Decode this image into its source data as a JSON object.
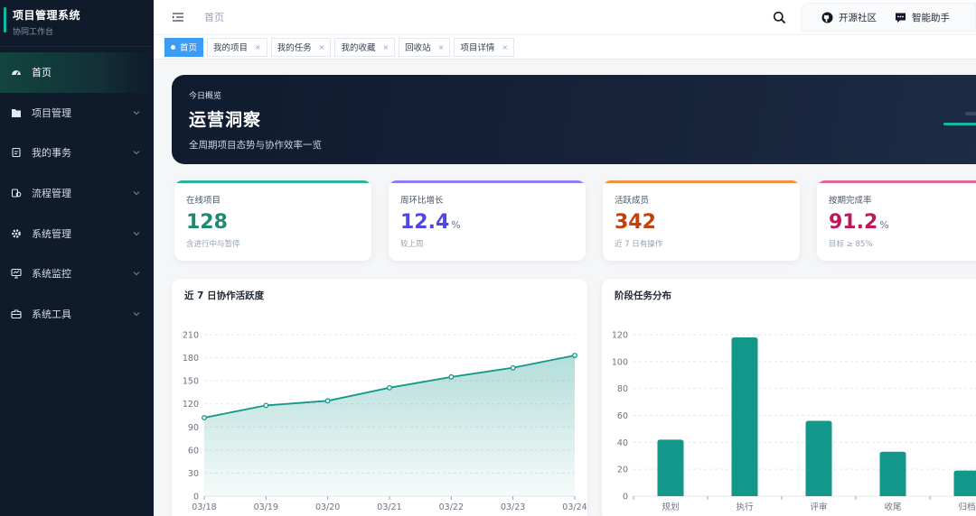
{
  "sidebar": {
    "brand_title": "项目管理系统",
    "brand_subtitle": "协同工作台",
    "items": [
      {
        "label": "首页",
        "icon": "dashboard-icon",
        "active": true,
        "expandable": false
      },
      {
        "label": "项目管理",
        "icon": "folder-icon",
        "active": false,
        "expandable": true
      },
      {
        "label": "我的事务",
        "icon": "task-icon",
        "active": false,
        "expandable": true
      },
      {
        "label": "流程管理",
        "icon": "workflow-icon",
        "active": false,
        "expandable": true
      },
      {
        "label": "系统管理",
        "icon": "gear-icon",
        "active": false,
        "expandable": true
      },
      {
        "label": "系统监控",
        "icon": "monitor-icon",
        "active": false,
        "expandable": true
      },
      {
        "label": "系统工具",
        "icon": "toolbox-icon",
        "active": false,
        "expandable": true
      }
    ]
  },
  "header": {
    "breadcrumb": "首页",
    "open_source_label": "开源社区",
    "assistant_label": "智能助手"
  },
  "tabs": [
    {
      "label": "首页",
      "active": true,
      "closable": false
    },
    {
      "label": "我的项目",
      "active": false,
      "closable": true
    },
    {
      "label": "我的任务",
      "active": false,
      "closable": true
    },
    {
      "label": "我的收藏",
      "active": false,
      "closable": true
    },
    {
      "label": "回收站",
      "active": false,
      "closable": true
    },
    {
      "label": "项目详情",
      "active": false,
      "closable": true
    }
  ],
  "tab_close_glyph": "×",
  "hero": {
    "kicker": "今日概览",
    "title": "运营洞察",
    "subtitle": "全周期项目态势与协作效率一览"
  },
  "stats": [
    {
      "label": "在线项目",
      "value": "128",
      "unit": "",
      "sub": "含进行中与暂停",
      "color": "#1f8a70"
    },
    {
      "label": "周环比增长",
      "value": "12.4",
      "unit": "%",
      "sub": "较上周",
      "color": "#4f46e5"
    },
    {
      "label": "活跃成员",
      "value": "342",
      "unit": "",
      "sub": "近 7 日有操作",
      "color": "#c2410c"
    },
    {
      "label": "按期完成率",
      "value": "91.2",
      "unit": "%",
      "sub": "目标 ≥ 85%",
      "color": "#be185d"
    }
  ],
  "colors": {
    "accent": "#14b8a6",
    "chart_primary": "#12978a",
    "sidebar_bg": "#0f1a2b",
    "tab_active": "#3b9cf5"
  },
  "chart_data": [
    {
      "type": "area",
      "title": "近 7 日协作活跃度",
      "categories": [
        "03/18",
        "03/19",
        "03/20",
        "03/21",
        "03/22",
        "03/23",
        "03/24"
      ],
      "values": [
        102,
        118,
        124,
        141,
        155,
        167,
        183
      ],
      "ylim": [
        0,
        210
      ],
      "yticks": [
        0,
        30,
        60,
        90,
        120,
        150,
        180,
        210
      ],
      "grid": true
    },
    {
      "type": "bar",
      "title": "阶段任务分布",
      "categories": [
        "规划",
        "执行",
        "评审",
        "收尾",
        "归档"
      ],
      "values": [
        42,
        118,
        56,
        33,
        19
      ],
      "ylim": [
        0,
        120
      ],
      "yticks": [
        0,
        20,
        40,
        60,
        80,
        100,
        120
      ],
      "grid": true
    }
  ]
}
